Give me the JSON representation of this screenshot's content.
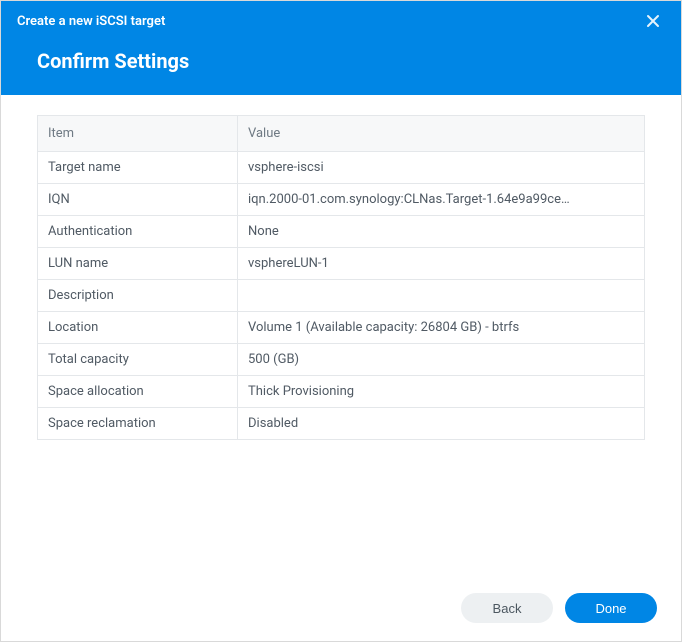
{
  "dialog": {
    "title": "Create a new iSCSI target",
    "subtitle": "Confirm Settings"
  },
  "table": {
    "headers": {
      "item": "Item",
      "value": "Value"
    },
    "rows": [
      {
        "item": "Target name",
        "value": "vsphere-iscsi"
      },
      {
        "item": "IQN",
        "value": "iqn.2000-01.com.synology:CLNas.Target-1.64e9a99ce…"
      },
      {
        "item": "Authentication",
        "value": "None"
      },
      {
        "item": "LUN name",
        "value": "vsphereLUN-1"
      },
      {
        "item": "Description",
        "value": ""
      },
      {
        "item": "Location",
        "value": "Volume 1 (Available capacity: 26804 GB) - btrfs"
      },
      {
        "item": "Total capacity",
        "value": "500 (GB)"
      },
      {
        "item": "Space allocation",
        "value": "Thick Provisioning"
      },
      {
        "item": "Space reclamation",
        "value": "Disabled"
      }
    ]
  },
  "buttons": {
    "back": "Back",
    "done": "Done"
  }
}
